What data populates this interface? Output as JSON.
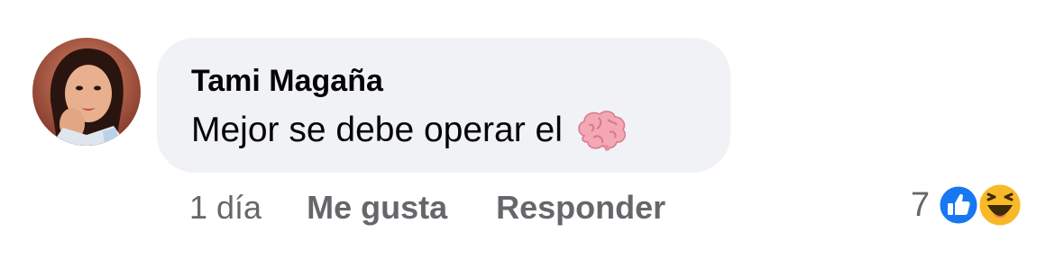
{
  "comment": {
    "author": "Tami Magaña",
    "text": "Mejor se debe operar el",
    "emoji": "brain-emoji"
  },
  "actions": {
    "time": "1 día",
    "like_label": "Me gusta",
    "reply_label": "Responder"
  },
  "reactions": {
    "count": "7",
    "types": [
      "like",
      "haha"
    ]
  },
  "colors": {
    "bubble_bg": "#f0f2f5",
    "text_primary": "#050505",
    "text_secondary": "#65676b",
    "like_blue": "#1877f2",
    "haha_yellow": "#f7b928"
  }
}
